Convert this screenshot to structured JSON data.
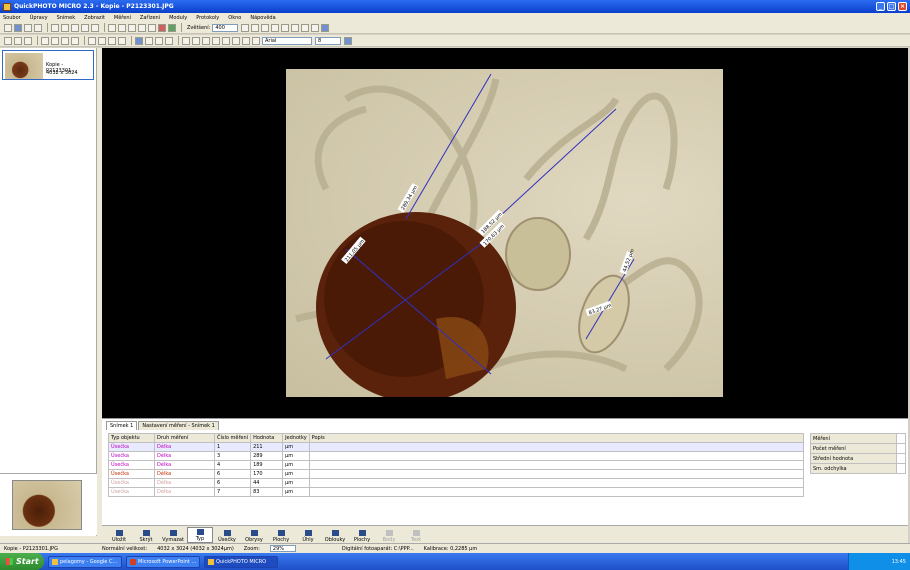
{
  "window": {
    "title": "QuickPHOTO MICRO 2.3 - Kopie - P2123301.JPG"
  },
  "menu": [
    "Soubor",
    "Úpravy",
    "Snímek",
    "Zobrazit",
    "Měření",
    "Zařízení",
    "Moduly",
    "Protokoly",
    "Okno",
    "Nápověda"
  ],
  "toolbar1": {
    "zoom_label": "Zvětšení:",
    "zoom_value": "400"
  },
  "toolbar2": {
    "font_value": "Arial",
    "size_value": "8"
  },
  "thumbnail": {
    "name": "Kopie - P2123301...",
    "size": "4032 x 3024"
  },
  "tabs": [
    "Snímek 1",
    "Nastavení měření - Snímek 1"
  ],
  "grid": {
    "headers": [
      "Typ objektu",
      "Druh měření",
      "Číslo měření",
      "Hodnota",
      "Jednotky",
      "Popis"
    ],
    "rows": [
      {
        "type": "Úsečka",
        "kind": "Délka",
        "num": "1",
        "value": "211",
        "unit": "µm",
        "color": "#c000c0"
      },
      {
        "type": "Úsečka",
        "kind": "Délka",
        "num": "3",
        "value": "289",
        "unit": "µm",
        "color": "#c000c0"
      },
      {
        "type": "Úsečka",
        "kind": "Délka",
        "num": "4",
        "value": "189",
        "unit": "µm",
        "color": "#c000c0"
      },
      {
        "type": "Úsečka",
        "kind": "Délka",
        "num": "6",
        "value": "170",
        "unit": "µm",
        "color": "#c03000"
      },
      {
        "type": "Úsečka",
        "kind": "Délka",
        "num": "6",
        "value": "44",
        "unit": "µm",
        "color": "#d0a0a0"
      },
      {
        "type": "Úsečka",
        "kind": "Délka",
        "num": "7",
        "value": "83",
        "unit": "µm",
        "color": "#d0a0a0"
      }
    ]
  },
  "stats": [
    {
      "label": "Měření"
    },
    {
      "label": "Počet měření"
    },
    {
      "label": "Střední hodnota"
    },
    {
      "label": "Sm. odchylka"
    }
  ],
  "buttons": [
    {
      "label": "Uložit",
      "enabled": true
    },
    {
      "label": "Skrýt",
      "enabled": true
    },
    {
      "label": "Vymazat",
      "enabled": true
    },
    {
      "label": "Typ",
      "enabled": true,
      "active": true
    },
    {
      "label": "Úsečky",
      "enabled": true
    },
    {
      "label": "Obrysy",
      "enabled": true
    },
    {
      "label": "Plochy",
      "enabled": true
    },
    {
      "label": "Úhly",
      "enabled": true
    },
    {
      "label": "Oblouky",
      "enabled": true
    },
    {
      "label": "Plochy",
      "enabled": true
    },
    {
      "label": "Body",
      "enabled": false
    },
    {
      "label": "Text",
      "enabled": false
    }
  ],
  "status": {
    "file": "Kopie - P2123301.JPG",
    "resolution_label": "Normální velikost:",
    "resolution": "4032 x 3024 (4032 x 3024µm)",
    "zoom_label": "Zoom:",
    "zoom": "29%",
    "capture": "Digitální fotoaparát: C:\\PPP...",
    "coords": "Kalibrace: 0,2285 µm"
  },
  "taskbar": {
    "start": "Start",
    "tasks": [
      {
        "label": "pelagomy - Google C..."
      },
      {
        "label": "Microsoft PowerPoint ..."
      },
      {
        "label": "QuickPHOTO MICRO",
        "active": true
      }
    ],
    "time": "13:45"
  },
  "measurements": [
    {
      "label": "211,05 µm"
    },
    {
      "label": "289,34 µm"
    },
    {
      "label": "188,52 µm"
    },
    {
      "label": "170,63 µm"
    },
    {
      "label": "44,52 µm"
    },
    {
      "label": "83,27 µm"
    }
  ]
}
